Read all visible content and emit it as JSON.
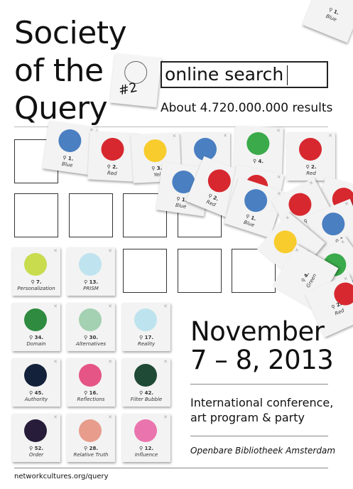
{
  "title_lines": [
    "Society",
    "of the",
    "Query"
  ],
  "badge": "#2",
  "search": {
    "query": "online search",
    "results": "About 4.720.000.000 results"
  },
  "colors": {
    "blue": "#4a7fc1",
    "red": "#d7282f",
    "yellow": "#f7cc2c",
    "green": "#3aaa4a",
    "personalization": "#c8dc4e",
    "prism": "#bfe3ef",
    "domain": "#2e8b3f",
    "alternatives": "#a3d1b1",
    "reality": "#bde3ee",
    "authority": "#14213a",
    "reflections": "#e55585",
    "filter_bubble": "#1f4a36",
    "order": "#271d3a",
    "relative_truth": "#e79c8c",
    "influence": "#ea74ad"
  },
  "top_cards": [
    {
      "num": "1.",
      "label": "Blue"
    },
    {
      "num": "2.",
      "label": "Red"
    },
    {
      "num": "3.",
      "label": "Yel"
    },
    {
      "num": "4.",
      "label": ""
    },
    {
      "num": "2.",
      "label": "Red"
    }
  ],
  "scatter_cards": [
    {
      "num": "1.",
      "label": "Blue"
    },
    {
      "num": "2.",
      "label": "Red"
    },
    {
      "num": "1.",
      "label": "Blue"
    },
    {
      "num": "2.",
      "label": "Re"
    },
    {
      "num": "3.",
      "label": "Yellow"
    },
    {
      "num": "1.",
      "label": "Blue"
    },
    {
      "num": "4.",
      "label": "Green"
    },
    {
      "num": "4.",
      "label": "Green"
    },
    {
      "num": "2.",
      "label": "Red"
    },
    {
      "num": "1.",
      "label": "Blue"
    }
  ],
  "cards": [
    {
      "num": "7.",
      "label": "Personalization"
    },
    {
      "num": "13.",
      "label": "PRISM"
    },
    {
      "num": "34.",
      "label": "Domain"
    },
    {
      "num": "30.",
      "label": "Alternatives"
    },
    {
      "num": "17.",
      "label": "Reality"
    },
    {
      "num": "45.",
      "label": "Authority"
    },
    {
      "num": "16.",
      "label": "Reflections"
    },
    {
      "num": "42.",
      "label": "Filter Bubble"
    },
    {
      "num": "52.",
      "label": "Order"
    },
    {
      "num": "28.",
      "label": "Relative Truth"
    },
    {
      "num": "12.",
      "label": "Influence"
    }
  ],
  "event": {
    "month": "November",
    "dates": "7 – 8, 2013",
    "line1": "International conference,",
    "line2": "art program & party",
    "venue": "Openbare Bibliotheek Amsterdam"
  },
  "url": "networkcultures.org/query"
}
